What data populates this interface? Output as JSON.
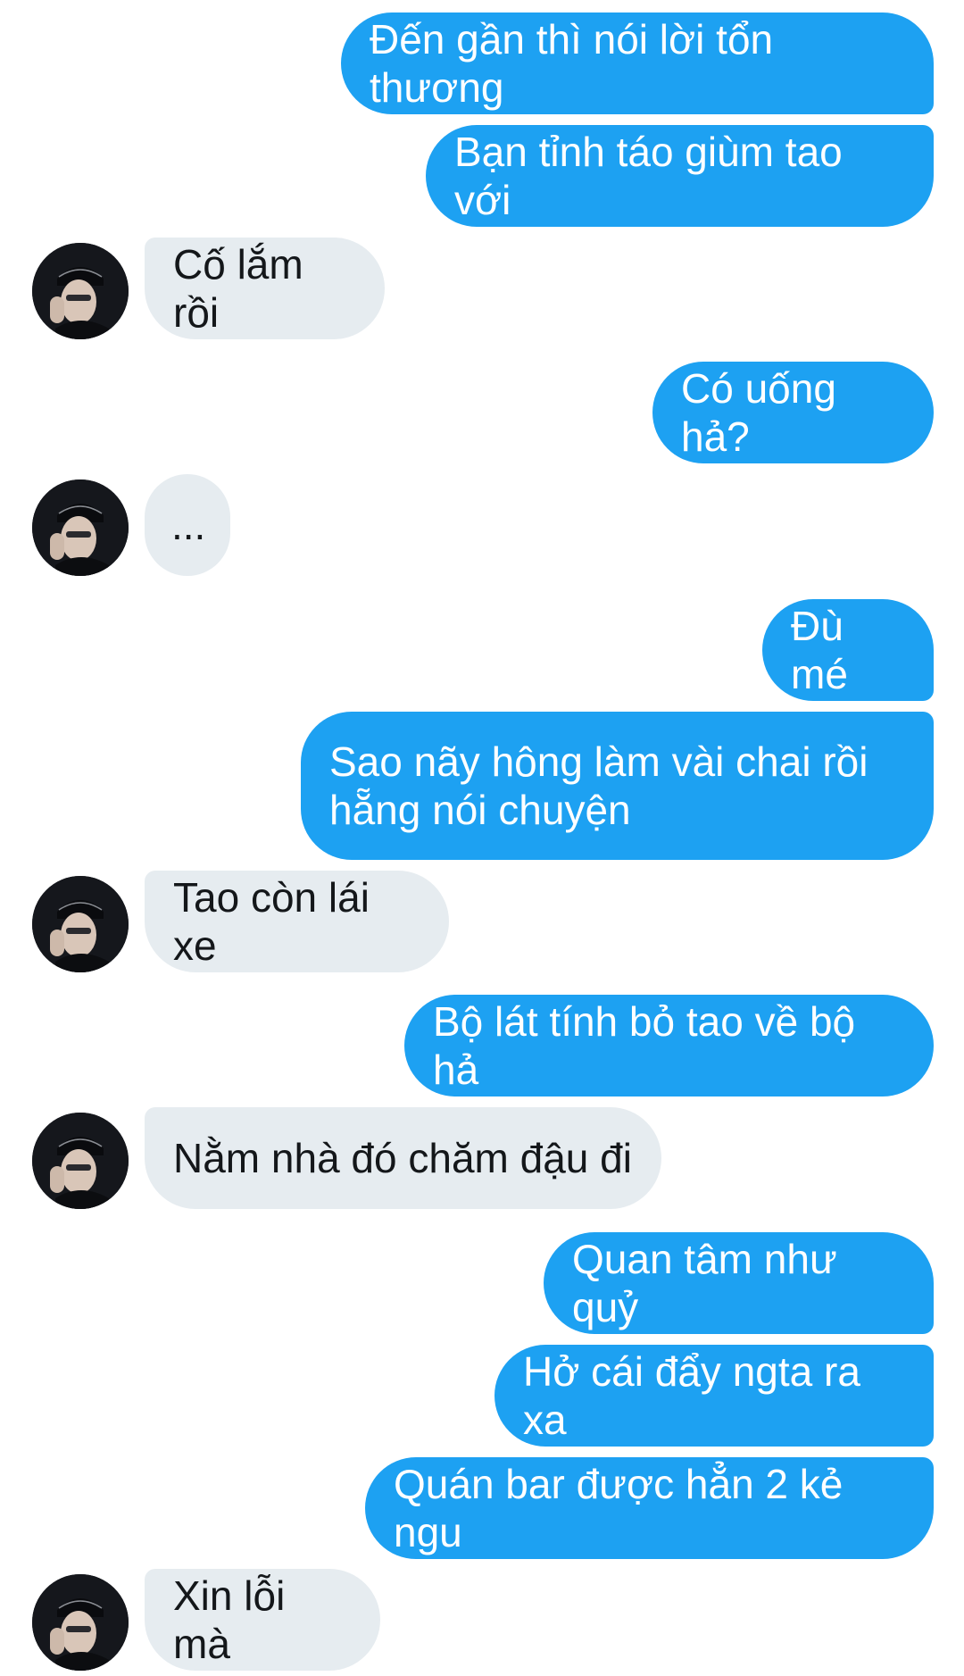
{
  "conversation": {
    "messages": [
      {
        "side": "sent",
        "text": "Đến gần thì nói lời tổn thương"
      },
      {
        "side": "sent",
        "text": "Bạn tỉnh táo giùm tao với"
      },
      {
        "side": "received",
        "text": "Cố lắm rồi"
      },
      {
        "side": "sent",
        "text": "Có uống hả?"
      },
      {
        "side": "received",
        "text": "..."
      },
      {
        "side": "sent",
        "text": "Đù mé"
      },
      {
        "side": "sent",
        "text": "Sao nãy hông làm vài chai rồi\nhẵng nói chuyện"
      },
      {
        "side": "received",
        "text": "Tao còn lái xe"
      },
      {
        "side": "sent",
        "text": "Bộ lát tính bỏ tao về bộ hả"
      },
      {
        "side": "received",
        "text": "Nằm nhà đó chăm đậu đi"
      },
      {
        "side": "sent",
        "text": "Quan tâm như quỷ"
      },
      {
        "side": "sent",
        "text": "Hở cái đẩy ngta ra xa"
      },
      {
        "side": "sent",
        "text": "Quán bar được hẳn 2 kẻ ngu"
      },
      {
        "side": "received",
        "text": "Xin lỗi mà"
      }
    ]
  },
  "colors": {
    "sent_bubble": "#1da1f2",
    "sent_text": "#ffffff",
    "received_bubble": "#e6ecf0",
    "received_text": "#14171a"
  },
  "icons": {
    "avatar": "contact-avatar-photo"
  }
}
